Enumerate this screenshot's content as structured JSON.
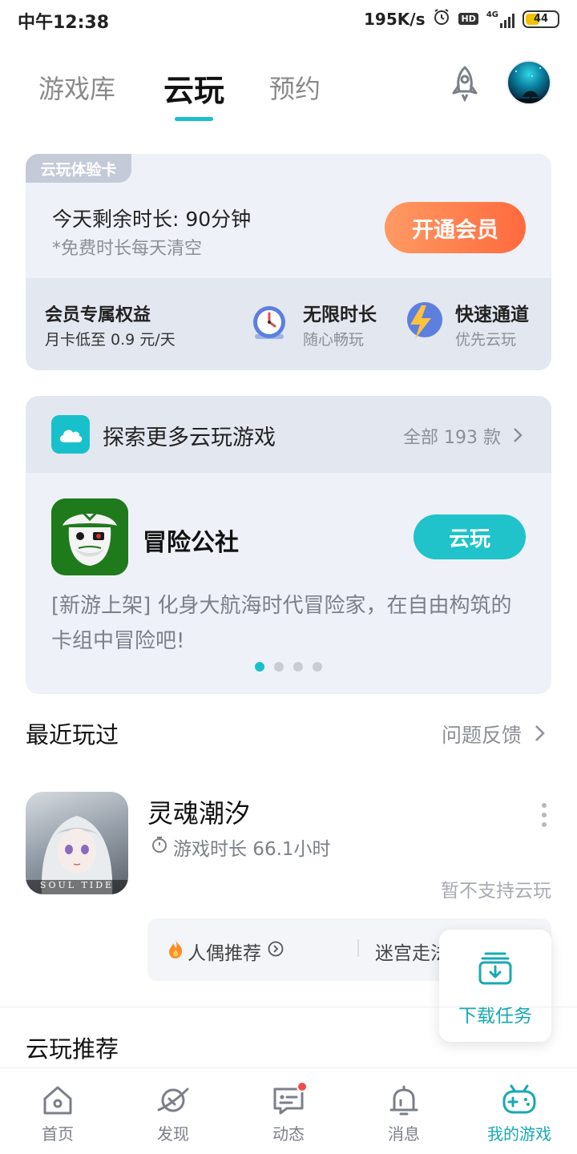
{
  "status_bar": {
    "time": "中午12:38",
    "net_speed": "195K/s",
    "hd": "HD",
    "network": "4G",
    "battery": "44",
    "battery_level_percent": 44
  },
  "top_tabs": [
    {
      "label": "游戏库",
      "active": false
    },
    {
      "label": "云玩",
      "active": true
    },
    {
      "label": "预约",
      "active": false
    }
  ],
  "trial_card": {
    "badge": "云玩体验卡",
    "remaining": "今天剩余时长: 90分钟",
    "note": "*免费时长每天清空",
    "vip_button": "开通会员",
    "benefits_title": "会员专属权益",
    "benefits_sub": "月卡低至 0.9 元/天",
    "benefits": [
      {
        "name": "无限时长",
        "desc": "随心畅玩",
        "icon": "alarm-clock-icon"
      },
      {
        "name": "快速通道",
        "desc": "优先云玩",
        "icon": "lightning-icon"
      }
    ]
  },
  "explore": {
    "title": "探索更多云玩游戏",
    "all_link": "全部 193 款",
    "featured_game": {
      "name": "冒险公社",
      "button": "云玩",
      "description": "[新游上架] 化身大航海时代冒险家，在自由构筑的卡组中冒险吧!"
    },
    "page_count": 4,
    "active_page": 1
  },
  "recent": {
    "title": "最近玩过",
    "feedback": "问题反馈",
    "game": {
      "name": "灵魂潮汐",
      "playtime": "游戏时长 66.1小时",
      "status": "暂不支持云玩",
      "icon_caption": "SOUL TIDE"
    },
    "tags": [
      {
        "label": "人偶推荐",
        "icon": "fire-icon"
      },
      {
        "label": "迷宫走法"
      }
    ]
  },
  "download_task": {
    "label": "下载任务",
    "icon": "download-tray-icon"
  },
  "cloud_recommend": {
    "title": "云玩推荐"
  },
  "bottom_nav": [
    {
      "label": "首页",
      "icon": "home-icon",
      "active": false
    },
    {
      "label": "发现",
      "icon": "planet-icon",
      "active": false
    },
    {
      "label": "动态",
      "icon": "chat-icon",
      "active": false,
      "badge": true
    },
    {
      "label": "消息",
      "icon": "bell-icon",
      "active": false
    },
    {
      "label": "我的游戏",
      "icon": "gamepad-icon",
      "active": true
    }
  ],
  "colors": {
    "accent": "#18c0cc",
    "vip_orange": "#ff6a3d",
    "card_bg": "#eef1f8"
  }
}
